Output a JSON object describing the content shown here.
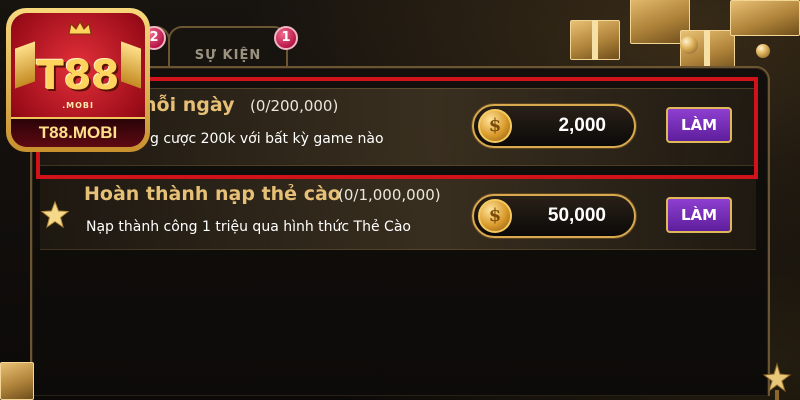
{
  "logo": {
    "mark": "T88",
    "sub": ".MOBI",
    "banner": "T88.MOBI"
  },
  "tabs": {
    "left_badge": "2",
    "events_label": "SỰ KIỆN",
    "events_badge": "1"
  },
  "tasks": [
    {
      "title": "hỗi ngày",
      "progress": "(0/200,000)",
      "description": "g cược 200k với bất kỳ game nào",
      "reward": "2,000",
      "button": "LÀM",
      "highlighted": true
    },
    {
      "title": "Hoàn thành nạp thẻ cào",
      "progress": "(0/1,000,000)",
      "description": "Nạp thành công 1 triệu qua hình thức Thẻ Cào",
      "reward": "50,000",
      "button": "LÀM",
      "highlighted": false
    }
  ],
  "icons": {
    "coin": "coin-icon",
    "star": "star-icon",
    "gift": "gift-icon"
  },
  "colors": {
    "title_gold": "#e6c076",
    "button_purple": "#7a2fbf",
    "highlight_red": "#d0121b",
    "badge_red": "#b81848"
  }
}
